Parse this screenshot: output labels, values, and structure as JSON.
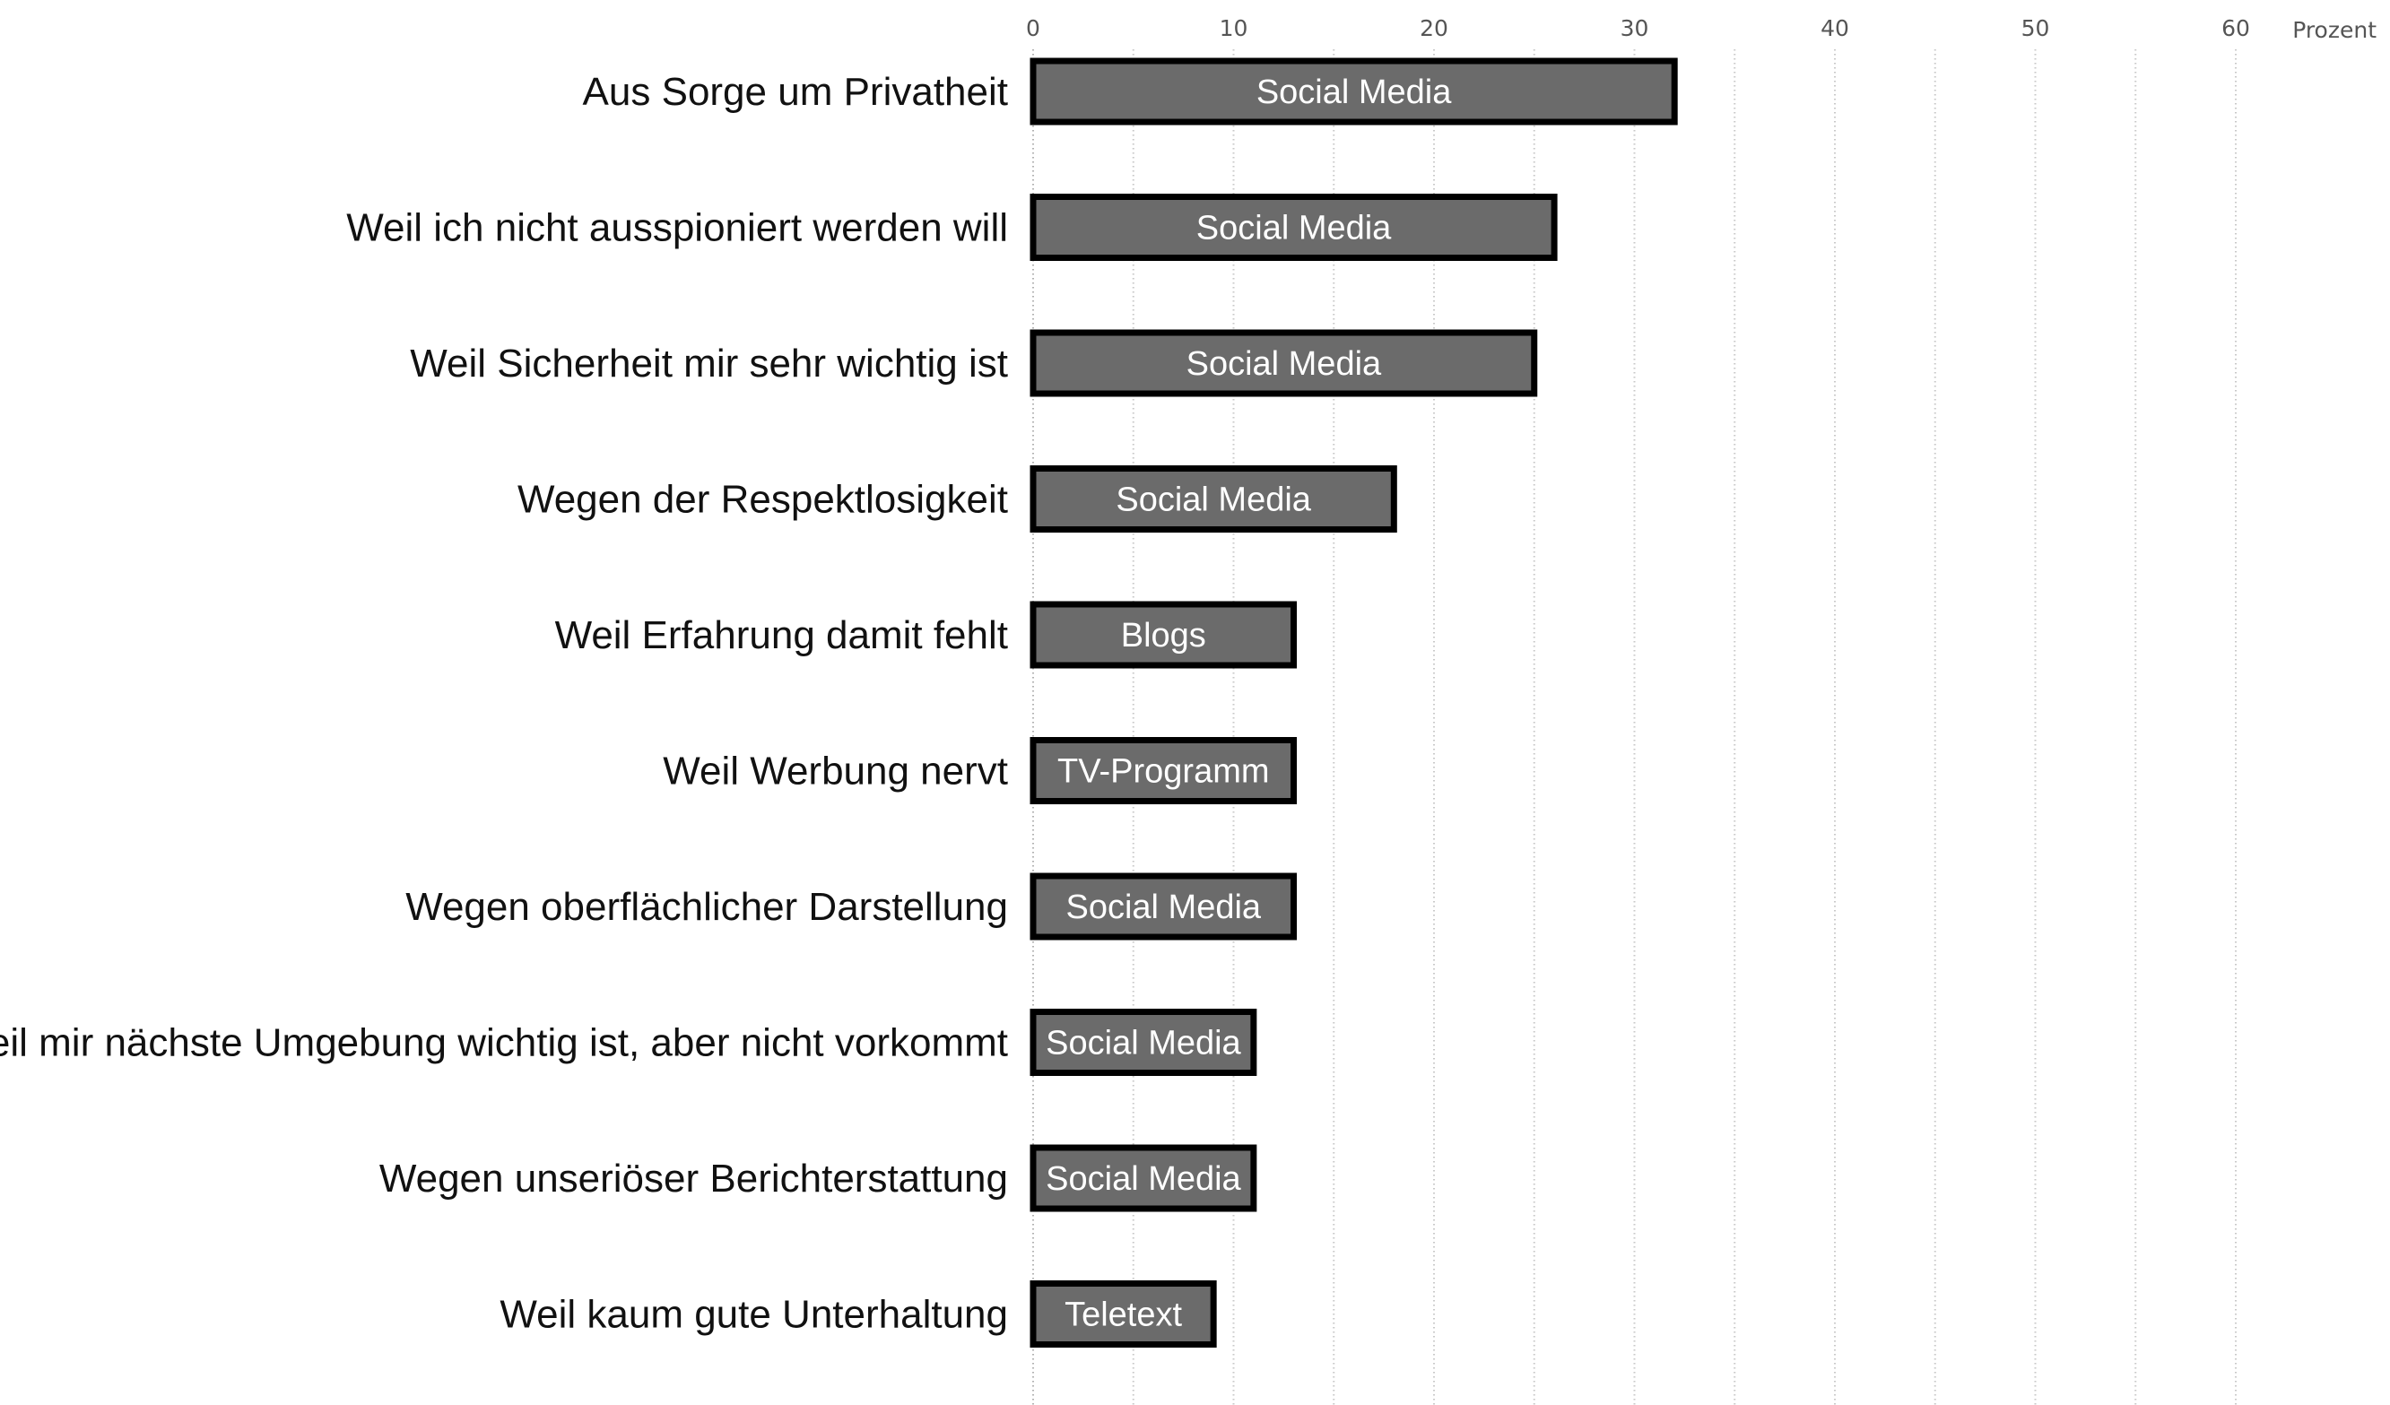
{
  "chart_data": {
    "type": "bar",
    "orientation": "horizontal",
    "categories": [
      "Aus Sorge um Privatheit",
      "Weil ich nicht ausspioniert werden will",
      "Weil Sicherheit mir sehr wichtig ist",
      "Wegen der Respektlosigkeit",
      "Weil Erfahrung damit fehlt",
      "Weil Werbung nervt",
      "Wegen oberflächlicher Darstellung",
      "Weil mir nächste Umgebung wichtig ist, aber nicht vorkommt",
      "Wegen unseriöser Berichterstattung",
      "Weil kaum gute Unterhaltung"
    ],
    "values": [
      32,
      26,
      25,
      18,
      13,
      13,
      13,
      11,
      11,
      9
    ],
    "bar_labels": [
      "Social Media",
      "Social Media",
      "Social Media",
      "Social Media",
      "Blogs",
      "TV-Programm",
      "Social Media",
      "Social Media",
      "Social Media",
      "Teletext"
    ],
    "x_ticks": [
      "0",
      "10",
      "20",
      "30",
      "40",
      "50",
      "60"
    ],
    "x_tick_values": [
      0,
      10,
      20,
      30,
      40,
      50,
      60
    ],
    "xlabel": "Prozent",
    "xlim": [
      0,
      67
    ],
    "grid": true,
    "colors": {
      "bar_fill": "#6b6b6b",
      "bar_stroke": "#000000",
      "bar_text": "#ffffff",
      "grid": "#c8c8c8"
    }
  }
}
